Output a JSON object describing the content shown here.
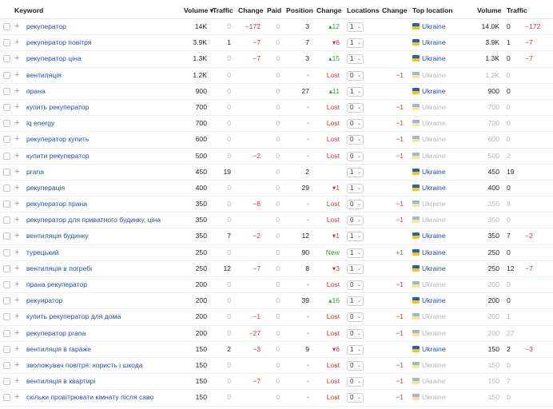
{
  "headers": {
    "keyword": "Keyword",
    "volume": "Volume",
    "sort_icon": "▾",
    "traffic": "Traffic",
    "change": "Change",
    "paid": "Paid",
    "position": "Position",
    "pos_change": "Change",
    "locations": "Locations",
    "loc_change": "Change",
    "top_location": "Top location",
    "volume2": "Volume",
    "traffic2": "Traffic"
  },
  "icons": {
    "checkbox": "checkbox-icon",
    "expand": "plus-icon",
    "flag": "ukraine-flag-icon",
    "dropdown": "chevron-down-icon"
  },
  "colors": {
    "link": "#1f4fa8",
    "negative": "#d9302c",
    "positive": "#2f9e44",
    "muted": "#b5b5b5",
    "flag_blue": "#2b5fb5",
    "flag_yellow": "#f2c71c"
  },
  "rows": [
    {
      "keyword": "рекуператор",
      "volume": "14K",
      "traffic": "0",
      "change": "−172",
      "paid": "0",
      "position": "3",
      "pos_change": "12",
      "pos_dir": "up",
      "locations": "1",
      "loc_change": "",
      "country": "Ukraine",
      "country_on": true,
      "volume2": "14.0K",
      "traffic2": "0",
      "change2": "−172"
    },
    {
      "keyword": "рекуператор повітря",
      "volume": "3.9K",
      "traffic": "1",
      "change": "−7",
      "paid": "0",
      "position": "7",
      "pos_change": "6",
      "pos_dir": "down",
      "locations": "1",
      "loc_change": "",
      "country": "Ukraine",
      "country_on": true,
      "volume2": "3.9K",
      "traffic2": "1",
      "change2": "−7"
    },
    {
      "keyword": "рекуператор ціна",
      "volume": "1.3K",
      "traffic": "0",
      "change": "−7",
      "paid": "0",
      "position": "3",
      "pos_change": "15",
      "pos_dir": "up",
      "locations": "1",
      "loc_change": "",
      "country": "Ukraine",
      "country_on": true,
      "volume2": "1.3K",
      "traffic2": "0",
      "change2": "−7"
    },
    {
      "keyword": "вентиляція",
      "volume": "1.2K",
      "traffic": "0",
      "change": "",
      "paid": "0",
      "position": "-",
      "pos_change": "Lost",
      "pos_dir": "lost",
      "locations": "0",
      "loc_change": "−1",
      "country": "Ukraine",
      "country_on": false,
      "volume2": "1.2K",
      "traffic2": "0",
      "change2": ""
    },
    {
      "keyword": "прана",
      "volume": "900",
      "traffic": "0",
      "change": "",
      "paid": "0",
      "position": "27",
      "pos_change": "11",
      "pos_dir": "up",
      "locations": "1",
      "loc_change": "",
      "country": "Ukraine",
      "country_on": true,
      "volume2": "900",
      "traffic2": "0",
      "change2": ""
    },
    {
      "keyword": "купить рекуператор",
      "volume": "700",
      "traffic": "0",
      "change": "",
      "paid": "0",
      "position": "-",
      "pos_change": "Lost",
      "pos_dir": "lost",
      "locations": "0",
      "loc_change": "−1",
      "country": "Ukraine",
      "country_on": false,
      "volume2": "700",
      "traffic2": "0",
      "change2": ""
    },
    {
      "keyword": "iq energy",
      "volume": "700",
      "traffic": "0",
      "change": "",
      "paid": "0",
      "position": "-",
      "pos_change": "Lost",
      "pos_dir": "lost",
      "locations": "0",
      "loc_change": "−1",
      "country": "Ukraine",
      "country_on": false,
      "volume2": "700",
      "traffic2": "0",
      "change2": ""
    },
    {
      "keyword": "рекуператор купить",
      "volume": "600",
      "traffic": "0",
      "change": "",
      "paid": "0",
      "position": "-",
      "pos_change": "Lost",
      "pos_dir": "lost",
      "locations": "0",
      "loc_change": "−1",
      "country": "Ukraine",
      "country_on": false,
      "volume2": "600",
      "traffic2": "0",
      "change2": ""
    },
    {
      "keyword": "купити рекуператор",
      "volume": "500",
      "traffic": "0",
      "change": "−2",
      "paid": "0",
      "position": "-",
      "pos_change": "Lost",
      "pos_dir": "lost",
      "locations": "0",
      "loc_change": "−1",
      "country": "Ukraine",
      "country_on": false,
      "volume2": "500",
      "traffic2": "2",
      "change2": ""
    },
    {
      "keyword": "prana",
      "volume": "450",
      "traffic": "19",
      "change": "",
      "paid": "0",
      "position": "2",
      "pos_change": "",
      "pos_dir": "none",
      "locations": "1",
      "loc_change": "",
      "country": "Ukraine",
      "country_on": true,
      "volume2": "450",
      "traffic2": "19",
      "change2": ""
    },
    {
      "keyword": "рекуперація",
      "volume": "400",
      "traffic": "0",
      "change": "",
      "paid": "0",
      "position": "29",
      "pos_change": "1",
      "pos_dir": "down",
      "locations": "1",
      "loc_change": "",
      "country": "Ukraine",
      "country_on": true,
      "volume2": "400",
      "traffic2": "0",
      "change2": ""
    },
    {
      "keyword": "рекуператор прана",
      "volume": "350",
      "traffic": "0",
      "change": "−8",
      "paid": "0",
      "position": "-",
      "pos_change": "Lost",
      "pos_dir": "lost",
      "locations": "0",
      "loc_change": "−1",
      "country": "Ukraine",
      "country_on": false,
      "volume2": "350",
      "traffic2": "8",
      "change2": ""
    },
    {
      "keyword": "рекуператор для приватного будинку, ціна",
      "volume": "350",
      "traffic": "0",
      "change": "",
      "paid": "0",
      "position": "-",
      "pos_change": "Lost",
      "pos_dir": "lost",
      "locations": "0",
      "loc_change": "−1",
      "country": "Ukraine",
      "country_on": false,
      "volume2": "350",
      "traffic2": "0",
      "change2": ""
    },
    {
      "keyword": "вентиляція будинку",
      "volume": "350",
      "traffic": "7",
      "change": "−2",
      "paid": "0",
      "position": "12",
      "pos_change": "1",
      "pos_dir": "down",
      "locations": "1",
      "loc_change": "",
      "country": "Ukraine",
      "country_on": true,
      "volume2": "350",
      "traffic2": "7",
      "change2": "−2"
    },
    {
      "keyword": "турецький",
      "volume": "250",
      "traffic": "0",
      "change": "",
      "paid": "0",
      "position": "90",
      "pos_change": "New",
      "pos_dir": "new",
      "locations": "1",
      "loc_change": "+1",
      "country": "Ukraine",
      "country_on": true,
      "volume2": "250",
      "traffic2": "0",
      "change2": ""
    },
    {
      "keyword": "вентиляція в погребі",
      "volume": "250",
      "traffic": "12",
      "change": "−7",
      "paid": "0",
      "position": "8",
      "pos_change": "3",
      "pos_dir": "down",
      "locations": "1",
      "loc_change": "",
      "country": "Ukraine",
      "country_on": true,
      "volume2": "250",
      "traffic2": "12",
      "change2": "−7"
    },
    {
      "keyword": "прана рекуператор",
      "volume": "200",
      "traffic": "0",
      "change": "",
      "paid": "0",
      "position": "-",
      "pos_change": "Lost",
      "pos_dir": "lost",
      "locations": "0",
      "loc_change": "−1",
      "country": "Ukraine",
      "country_on": false,
      "volume2": "200",
      "traffic2": "0",
      "change2": ""
    },
    {
      "keyword": "рекуиратор",
      "volume": "200",
      "traffic": "0",
      "change": "",
      "paid": "0",
      "position": "39",
      "pos_change": "16",
      "pos_dir": "up",
      "locations": "1",
      "loc_change": "",
      "country": "Ukraine",
      "country_on": true,
      "volume2": "200",
      "traffic2": "0",
      "change2": ""
    },
    {
      "keyword": "купить рекуператор для дома",
      "volume": "200",
      "traffic": "0",
      "change": "−1",
      "paid": "0",
      "position": "-",
      "pos_change": "Lost",
      "pos_dir": "lost",
      "locations": "0",
      "loc_change": "−1",
      "country": "Ukraine",
      "country_on": false,
      "volume2": "200",
      "traffic2": "1",
      "change2": ""
    },
    {
      "keyword": "рекуператор prana",
      "volume": "200",
      "traffic": "0",
      "change": "−27",
      "paid": "0",
      "position": "-",
      "pos_change": "Lost",
      "pos_dir": "lost",
      "locations": "0",
      "loc_change": "−1",
      "country": "Ukraine",
      "country_on": false,
      "volume2": "200",
      "traffic2": "27",
      "change2": ""
    },
    {
      "keyword": "вентиляція в гаражe",
      "volume": "150",
      "traffic": "2",
      "change": "−3",
      "paid": "0",
      "position": "9",
      "pos_change": "6",
      "pos_dir": "down",
      "locations": "1",
      "loc_change": "",
      "country": "Ukraine",
      "country_on": true,
      "volume2": "150",
      "traffic2": "2",
      "change2": "−3"
    },
    {
      "keyword": "зволожувач повітря: користь і шкода",
      "volume": "150",
      "traffic": "0",
      "change": "",
      "paid": "0",
      "position": "-",
      "pos_change": "Lost",
      "pos_dir": "lost",
      "locations": "0",
      "loc_change": "−1",
      "country": "Ukraine",
      "country_on": false,
      "volume2": "150",
      "traffic2": "0",
      "change2": ""
    },
    {
      "keyword": "вентиляція в квартирі",
      "volume": "150",
      "traffic": "0",
      "change": "−7",
      "paid": "0",
      "position": "-",
      "pos_change": "Lost",
      "pos_dir": "lost",
      "locations": "0",
      "loc_change": "−1",
      "country": "Ukraine",
      "country_on": false,
      "volume2": "150",
      "traffic2": "7",
      "change2": ""
    },
    {
      "keyword": "скільки провітрювати кімнату після саво",
      "volume": "150",
      "traffic": "0",
      "change": "",
      "paid": "0",
      "position": "-",
      "pos_change": "Lost",
      "pos_dir": "lost",
      "locations": "0",
      "loc_change": "−1",
      "country": "Ukraine",
      "country_on": false,
      "volume2": "150",
      "traffic2": "0",
      "change2": ""
    }
  ]
}
